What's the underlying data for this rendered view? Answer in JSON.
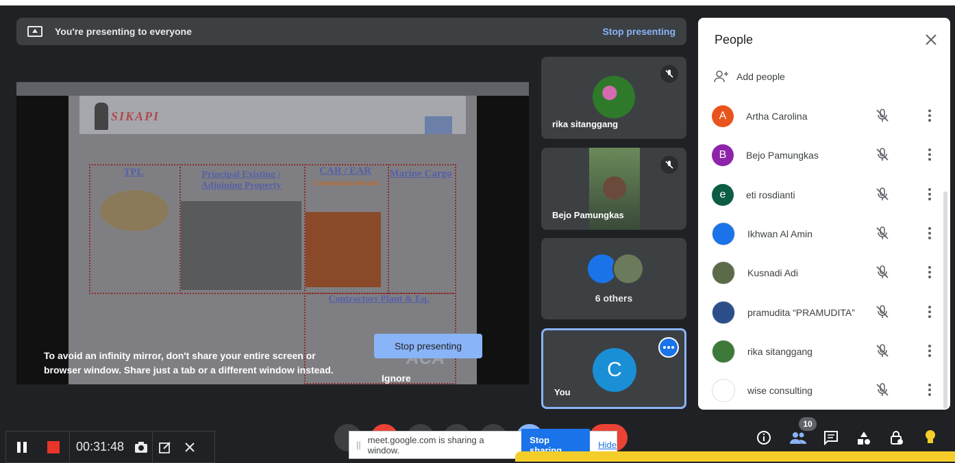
{
  "banner": {
    "text": "You're presenting to everyone",
    "stop": "Stop presenting"
  },
  "slide": {
    "logo": "SIKAPI",
    "items": [
      "TPL",
      "Principal Existing / Adjoining Property",
      "CAR / EAR",
      "Construction Period",
      "Marine Cargo",
      "Contractors Plant & Eq.",
      "ACA"
    ]
  },
  "mirror": {
    "message": "To avoid an infinity mirror, don't share your entire screen or browser window. Share just a tab or a different window instead.",
    "stop_button": "Stop presenting",
    "ignore": "Ignore"
  },
  "tiles": [
    {
      "name": "rika sitanggang"
    },
    {
      "name": "Bejo Pamungkas"
    },
    {
      "name": "6 others"
    },
    {
      "name": "You",
      "initial": "C"
    }
  ],
  "people": {
    "title": "People",
    "add": "Add people",
    "list": [
      {
        "initial": "A",
        "name": "Artha Carolina",
        "color": "#e8541c"
      },
      {
        "initial": "B",
        "name": "Bejo Pamungkas",
        "color": "#8e24aa"
      },
      {
        "initial": "e",
        "name": "eti rosdianti",
        "color": "#0d5c45"
      },
      {
        "initial": "",
        "name": "Ikhwan Al Amin",
        "color": "#1a73e8"
      },
      {
        "initial": "",
        "name": "Kusnadi Adi",
        "color": "#5b6b4a"
      },
      {
        "initial": "",
        "name": "pramudita “PRAMUDITA”",
        "color": "#2c4f8a"
      },
      {
        "initial": "",
        "name": "rika sitanggang",
        "color": "#3d7a3a"
      },
      {
        "initial": "",
        "name": "wise consulting",
        "color": "#ffffff"
      }
    ]
  },
  "recorder": {
    "time": "00:31:48"
  },
  "share_bar": {
    "text": "meet.google.com is sharing a window.",
    "stop": "Stop sharing",
    "hide": "Hide"
  },
  "participants_count": "10"
}
